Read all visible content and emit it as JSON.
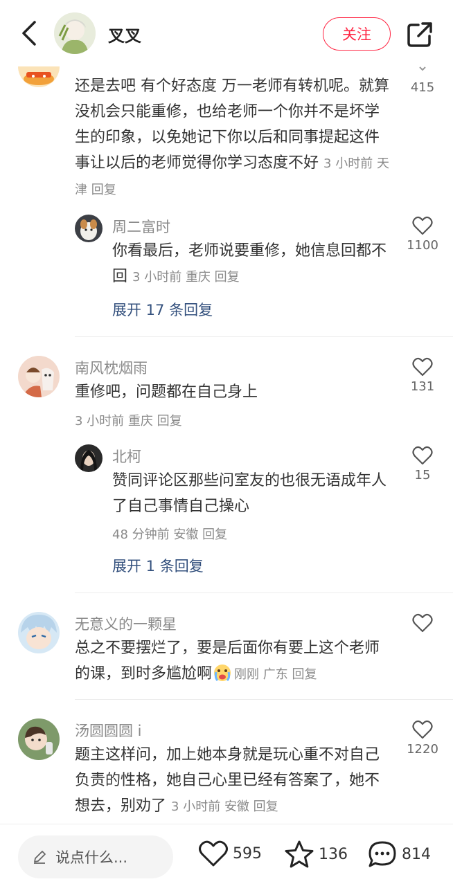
{
  "header": {
    "author_name": "叉叉",
    "follow_label": "关注"
  },
  "comments": [
    {
      "text": "还是去吧 有个好态度 万一老师有转机呢。就算没机会只能重修，也给老师一个你并不是坏学生的印象，以免她记下你以后和同事提起这件事让以后的老师觉得你学习态度不好",
      "time": "3 小时前",
      "location": "天津",
      "reply_label": "回复",
      "likes": "415",
      "replies": [
        {
          "user": "周二富时",
          "text": "你看最后，老师说要重修，她信息回都不回",
          "time": "3 小时前",
          "location": "重庆",
          "reply_label": "回复",
          "likes": "1100"
        }
      ],
      "expand_label": "展开 17 条回复"
    },
    {
      "user": "南风枕烟雨",
      "text": "重修吧，问题都在自己身上",
      "time": "3 小时前",
      "location": "重庆",
      "reply_label": "回复",
      "likes": "131",
      "replies": [
        {
          "user": "北柯",
          "text": "赞同评论区那些问室友的也很无语成年人了自己事情自己操心",
          "time": "48 分钟前",
          "location": "安徽",
          "reply_label": "回复",
          "likes": "15"
        }
      ],
      "expand_label": "展开 1 条回复"
    },
    {
      "user": "无意义的一颗星",
      "text": "总之不要摆烂了，要是后面你有要上这个老师的课，到时多尴尬啊",
      "time": "刚刚",
      "location": "广东",
      "reply_label": "回复",
      "likes": ""
    },
    {
      "user": "汤圆圆圆 i",
      "text": "题主这样问，加上她本身就是玩心重不对自己负责的性格，她自己心里已经有答案了，她不想去，别劝了",
      "time": "3 小时前",
      "location": "安徽",
      "reply_label": "回复",
      "likes": "1220"
    }
  ],
  "bottom_bar": {
    "input_placeholder": "说点什么...",
    "likes": "595",
    "stars": "136",
    "comments": "814"
  },
  "colors": {
    "accent": "#ff2442",
    "link": "#33507d",
    "muted": "#8a8a8a"
  }
}
